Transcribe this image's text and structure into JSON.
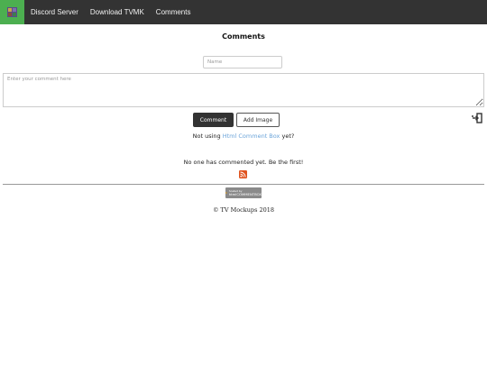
{
  "navbar": {
    "logo_icon": "tv-mockups-logo-icon",
    "links": [
      {
        "label": "Discord Server"
      },
      {
        "label": "Download TVMK"
      },
      {
        "label": "Comments"
      }
    ],
    "background": "#333333",
    "logo_background": "#4CAF50"
  },
  "comments": {
    "title": "Comments",
    "name_placeholder": "Name",
    "comment_placeholder": "Enter your comment here",
    "comment_button": "Comment",
    "add_image_button": "Add Image",
    "login_icon": "sign-in-icon",
    "not_using_prefix": "Not using",
    "not_using_link": "Html Comment Box",
    "not_using_suffix": "yet?",
    "no_comments": "No one has commented yet. Be the first!",
    "rss_icon": "rss-feed-icon",
    "rss_color": "#e0531f",
    "link_color": "#6aa3d9"
  },
  "badge": {
    "line1": "hosted by",
    "line2": "htmlCOMMENTBOX",
    "icon": "commentbox-logo-icon"
  },
  "footer": {
    "copyright": "© TV Mockups 2018"
  }
}
